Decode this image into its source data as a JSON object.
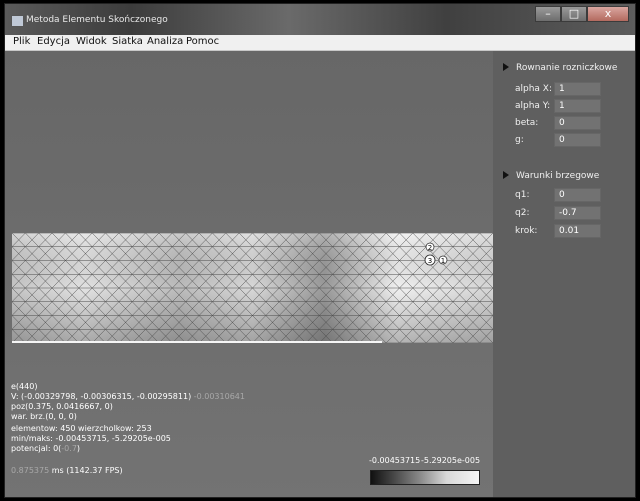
{
  "window": {
    "title": "Metoda Elementu Skończonego",
    "controls": {
      "minimize": "–",
      "maximize": "□",
      "close": "x"
    }
  },
  "menu": [
    "Plik",
    "Edycja",
    "Widok",
    "Siatka",
    "Analiza",
    "Pomoc"
  ],
  "panel": {
    "section1": {
      "title": "Rownanie rozniczkowe",
      "fields": [
        {
          "label": "alpha X:",
          "value": "1"
        },
        {
          "label": "alpha Y:",
          "value": "1"
        },
        {
          "label": "beta:",
          "value": "0"
        },
        {
          "label": "g:",
          "value": "0"
        }
      ]
    },
    "section2": {
      "title": "Warunki brzegowe",
      "fields": [
        {
          "label": "q1:",
          "value": "0"
        },
        {
          "label": "q2:",
          "value": "-0.7"
        },
        {
          "label": "krok:",
          "value": "0.01"
        }
      ]
    }
  },
  "mesh": {
    "node_labels": [
      "2",
      "3",
      "1"
    ]
  },
  "info": {
    "element": "e(440)",
    "v_line": "V: (-0.00329798, -0.00306315, -0.00295811)",
    "v_extra": "-0.00310641",
    "poz": "poz(0.375, 0.0416667, 0)",
    "warbrz": "war. brz.(0, 0, 0)",
    "counts": "elementow: 450 wierzcholkow: 253",
    "minmax": "min/maks: -0.00453715, -5.29205e-005",
    "potencjal_label": "potencjal: 0(",
    "potencjal_value": "-0.7",
    "potencjal_close": ")",
    "timing_value": "0.875375",
    "timing_rest": "ms (1142.37 FPS)"
  },
  "colorbar": {
    "min_label": "-0.00453715",
    "max_label": "-5.29205e-005"
  }
}
